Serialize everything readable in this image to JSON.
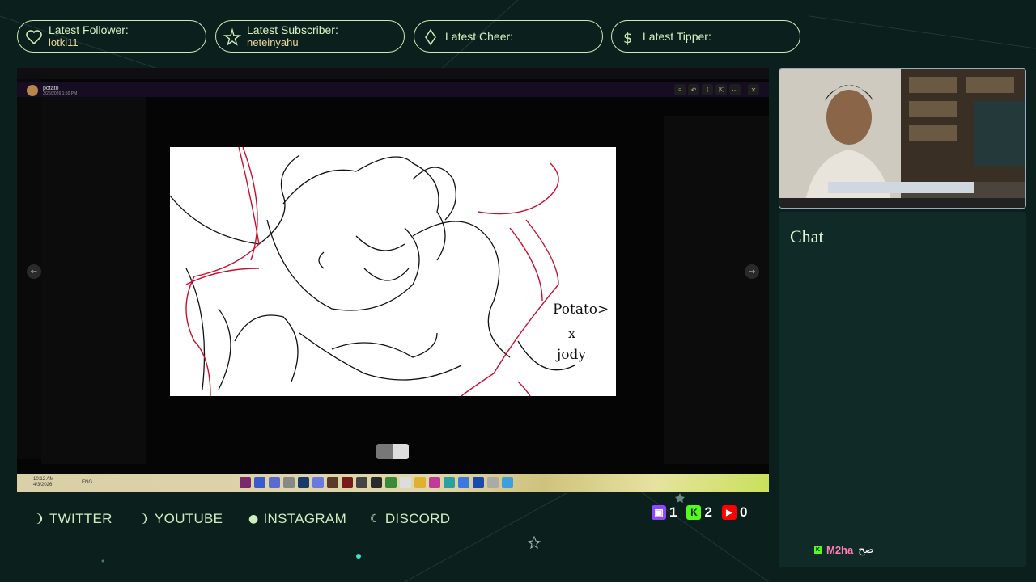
{
  "alerts": [
    {
      "label": "Latest Follower:",
      "value": "lotki11",
      "icon": "heart-icon"
    },
    {
      "label": "Latest Subscriber:",
      "value": "neteinyahu",
      "icon": "star-icon"
    },
    {
      "label": "Latest Cheer:",
      "value": "",
      "icon": "diamond-icon"
    },
    {
      "label": "Latest Tipper:",
      "value": "",
      "icon": "dollar-icon"
    }
  ],
  "screen": {
    "user_name": "potato",
    "user_date": "3/26/2026 1:50 PM",
    "drawing_text": [
      "Potato>",
      "x",
      "jody"
    ],
    "tool_glyphs": [
      "⌕",
      "↶",
      "⇩",
      "⇱",
      "⋯",
      "✕"
    ],
    "nav_prev": "←",
    "nav_next": "→"
  },
  "taskbar": {
    "time": "10:12 AM",
    "date": "4/3/2026",
    "lang": "ENG"
  },
  "socials": [
    {
      "glyph": "❩",
      "label": "TWITTER"
    },
    {
      "glyph": "❩",
      "label": "YOUTUBE"
    },
    {
      "glyph": "●",
      "label": "INSTAGRAM"
    },
    {
      "glyph": "☾",
      "label": "DISCORD"
    }
  ],
  "counts": [
    {
      "platform": "twitch",
      "badge": "▣",
      "value": "1",
      "color": "#9146ff"
    },
    {
      "platform": "kick",
      "badge": "K",
      "value": "2",
      "color": "#53fc18"
    },
    {
      "platform": "youtube",
      "badge": "▶",
      "value": "0",
      "color": "#ff0000"
    }
  ],
  "chat": {
    "title": "Chat",
    "messages": [
      {
        "badge": "K",
        "user": "M2ha",
        "text": "صح"
      }
    ]
  },
  "colors": {
    "accent": "#cfe9b8",
    "panel": "#0f2a27",
    "background": "#0b1f1d"
  }
}
